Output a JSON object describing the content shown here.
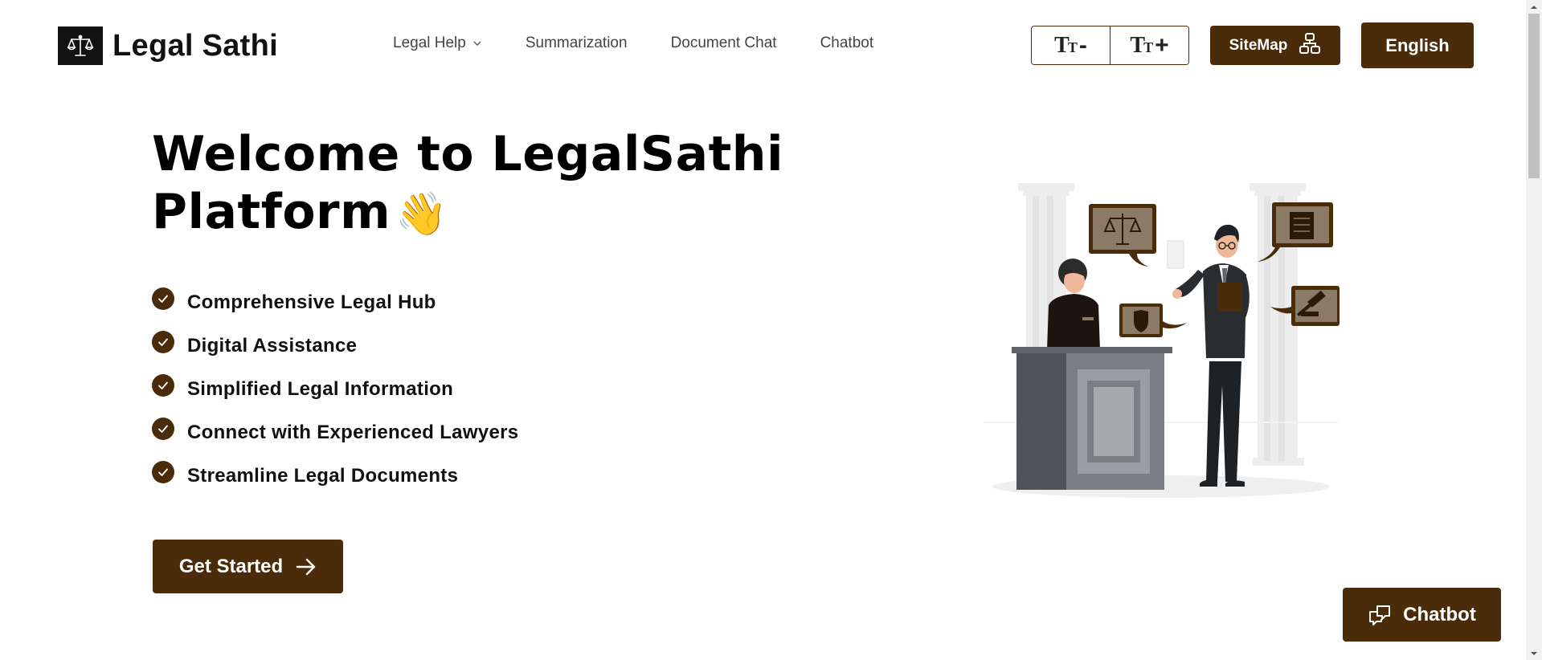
{
  "brand": {
    "name": "Legal Sathi"
  },
  "nav": {
    "items": [
      {
        "label": "Legal Help",
        "has_dropdown": true
      },
      {
        "label": "Summarization",
        "has_dropdown": false
      },
      {
        "label": "Document Chat",
        "has_dropdown": false
      },
      {
        "label": "Chatbot",
        "has_dropdown": false
      }
    ]
  },
  "font_controls": {
    "decrease_sign": "-",
    "increase_sign": "+",
    "glyph_big": "T",
    "glyph_small": "T"
  },
  "header_buttons": {
    "sitemap_label": "SiteMap",
    "language_label": "English"
  },
  "hero": {
    "title_line1": "Welcome to LegalSathi",
    "title_line2": "Platform",
    "wave_emoji": "👋",
    "features": [
      "Comprehensive Legal Hub",
      "Digital Assistance",
      "Simplified Legal Information",
      "Connect with Experienced Lawyers",
      "Streamline Legal Documents"
    ],
    "cta_label": "Get Started"
  },
  "chatbot_float": {
    "label": "Chatbot"
  },
  "colors": {
    "brand_brown": "#4a2c0a",
    "text_dark": "#111111",
    "nav_text": "#444444"
  }
}
